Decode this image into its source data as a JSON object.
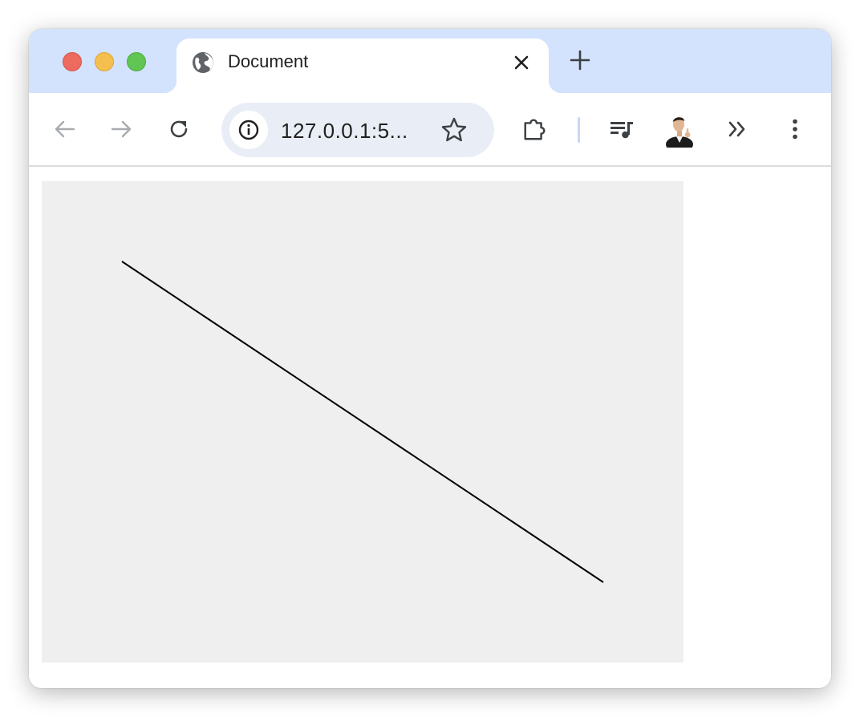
{
  "browser": {
    "tab": {
      "title": "Document",
      "favicon": "globe-icon",
      "close_icon": "close-icon"
    },
    "new_tab_icon": "plus-icon",
    "toolbar": {
      "back_icon": "arrow-left-icon",
      "forward_icon": "arrow-right-icon",
      "reload_icon": "reload-icon",
      "site_info_icon": "info-icon",
      "url": "127.0.0.1:5...",
      "bookmark_icon": "star-icon",
      "extensions_icon": "puzzle-icon",
      "media_icon": "playlist-music-icon",
      "profile": "avatar",
      "overflow_icon": "chevron-double-right-icon",
      "menu_icon": "more-vertical-icon"
    },
    "colors": {
      "tabstrip": "#d3e3fd",
      "omnibox": "#e9eef6",
      "canvas_background": "#efefef",
      "line": "#000000"
    }
  },
  "page": {
    "canvas": {
      "shape": "line",
      "stroke": "#000000"
    }
  }
}
